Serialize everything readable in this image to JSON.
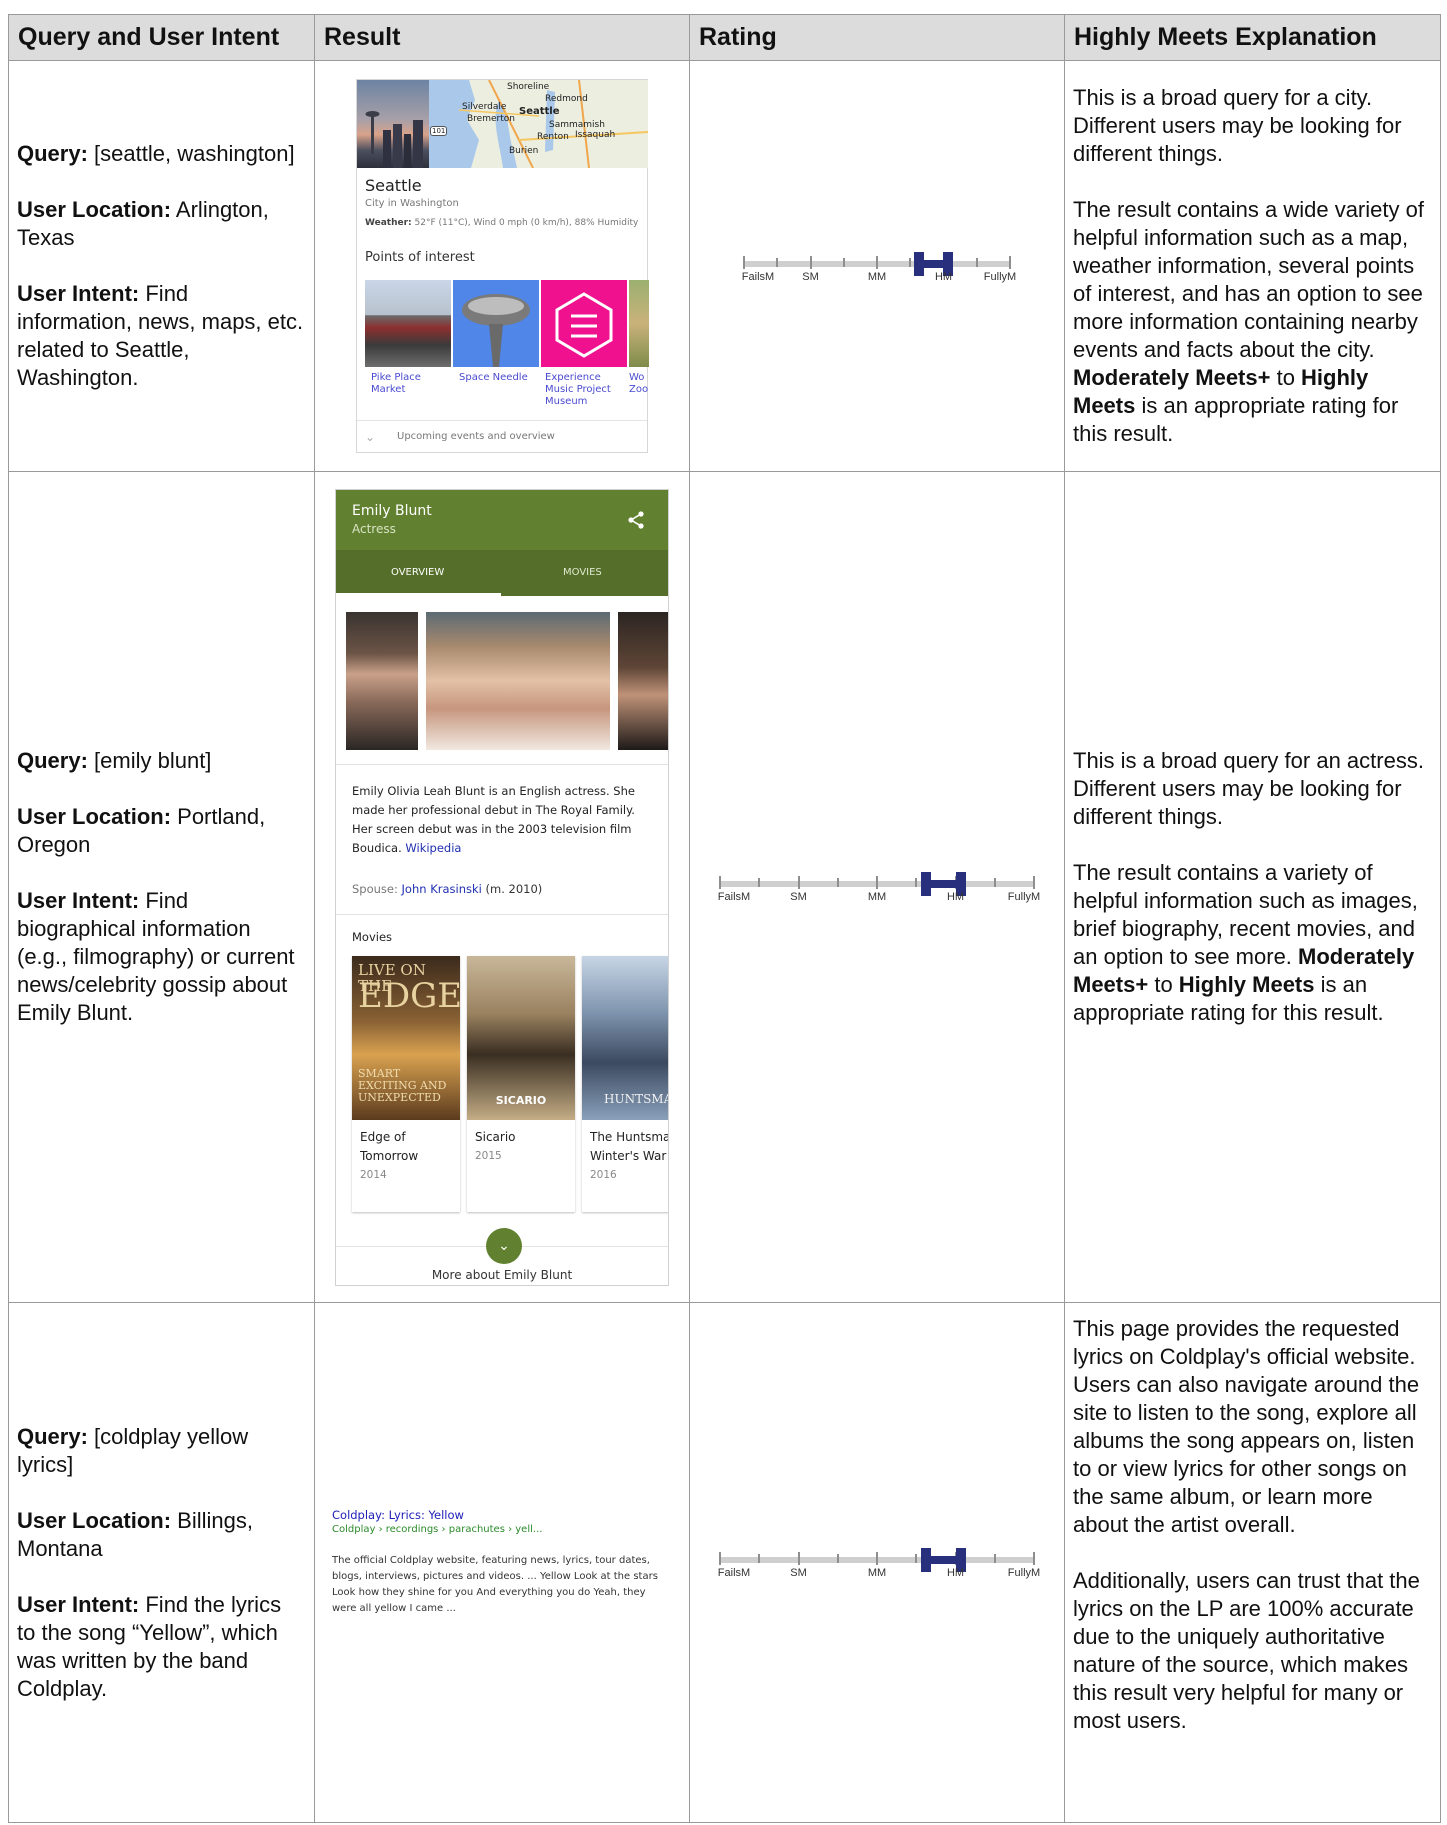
{
  "headers": [
    "Query and User Intent",
    "Result",
    "Rating",
    "Highly Meets Explanation"
  ],
  "rows": [
    {
      "query_label": "Query:",
      "query": " [seattle, washington]",
      "location_label": "User Location:",
      "location": " Arlington, Texas",
      "intent_label": "User Intent:",
      "intent": " Find information, news, maps, etc. related to Seattle, Washington.",
      "explanation_p1": "This is a broad query for a city. Different users may be looking for different things.",
      "explanation_p2a": "The result contains a wide variety of helpful information such as a map, weather information, several points of interest, and has an option to see more information containing nearby events and facts about the city. ",
      "explanation_bold1": "Moderately Meets+",
      "explanation_mid": " to ",
      "explanation_bold2": "Highly Meets",
      "explanation_end": " is an appropriate rating for this result."
    },
    {
      "query_label": "Query:",
      "query": " [emily blunt]",
      "location_label": "User Location:",
      "location": " Portland, Oregon",
      "intent_label": "User Intent:",
      "intent": " Find biographical information (e.g., filmography) or current news/celebrity gossip about Emily Blunt.",
      "explanation_p1": "This is a broad query for an actress. Different users may be looking for different things.",
      "explanation_p2a": "The result contains a variety of helpful information such as images, brief biography, recent movies, and an option to see more. ",
      "explanation_bold1": "Moderately Meets+",
      "explanation_mid": " to ",
      "explanation_bold2": "Highly Meets",
      "explanation_end": " is an appropriate rating for this result."
    },
    {
      "query_label": "Query:",
      "query": " [coldplay yellow lyrics]",
      "location_label": "User Location:",
      "location": " Billings, Montana",
      "intent_label": "User Intent:",
      "intent": " Find the lyrics to the song “Yellow”, which was written by the band Coldplay.",
      "explanation_p1": "This page provides the requested lyrics on Coldplay's official website. Users can also navigate around the site to listen to the song, explore all albums the song appears on, listen to or view lyrics for other songs on the same album, or learn more about the artist overall.",
      "explanation_p2": "Additionally, users can trust that the lyrics on the LP are 100% accurate due to the uniquely authoritative nature of the source, which makes this result very helpful for many or most users."
    }
  ],
  "rating_scale": {
    "labels": [
      "FailsM",
      "SM",
      "MM",
      "HM",
      "FullyM"
    ],
    "rows": [
      {
        "from": 2.6,
        "to": 3.1
      },
      {
        "from": 2.6,
        "to": 3.1
      },
      {
        "from": 2.6,
        "to": 3.1
      }
    ],
    "bar_color": "#28307e"
  },
  "seattle_card": {
    "map_labels": [
      "Shoreline",
      "Silverdale",
      "Redmond",
      "Seattle",
      "Bremerton",
      "Sammamish",
      "Renton",
      "Issaquah",
      "Burien",
      "101"
    ],
    "title": "Seattle",
    "subtitle": "City in Washington",
    "weather_label": "Weather:",
    "weather": " 52°F (11°C), Wind 0 mph (0 km/h), 88% Humidity",
    "poi_header": "Points of interest",
    "poi": [
      "Pike Place Market",
      "Space Needle",
      "Experience Music Project Museum",
      "Wo Zoo"
    ],
    "footer": "Upcoming events and overview"
  },
  "emily_card": {
    "name": "Emily Blunt",
    "role": "Actress",
    "tabs": [
      "OVERVIEW",
      "MOVIES"
    ],
    "bio": "Emily Olivia Leah Blunt is an English actress. She made her professional debut in The Royal Family. Her screen debut was in the 2003 television film Boudica. ",
    "bio_link": "Wikipedia",
    "spouse_label": "Spouse: ",
    "spouse": "John Krasinski",
    "spouse_year": " (m. 2010)",
    "movies_header": "Movies",
    "movies": [
      {
        "title1": "Edge of",
        "title2": "Tomorrow",
        "year": "2014",
        "poster_text1": "LIVE ON THE",
        "poster_text2": "EDGE",
        "poster_text3": "SMART EXCITING AND UNEXPECTED"
      },
      {
        "title1": "Sicario",
        "title2": "",
        "year": "2015",
        "poster_text1": "SICARIO"
      },
      {
        "title1": "The Huntsman:",
        "title2": "Winter's War",
        "year": "2016",
        "poster_text1": "HUNTSMAN"
      }
    ],
    "more": "More about Emily Blunt"
  },
  "coldplay_result": {
    "title": "Coldplay: Lyrics: Yellow",
    "url": "Coldplay › recordings › parachutes › yell...",
    "desc": "The official Coldplay website, featuring news, lyrics, tour dates, blogs, interviews, pictures and videos. ... Yellow Look at the stars Look how they shine for you And everything you do Yeah, they were all yellow I came ..."
  }
}
